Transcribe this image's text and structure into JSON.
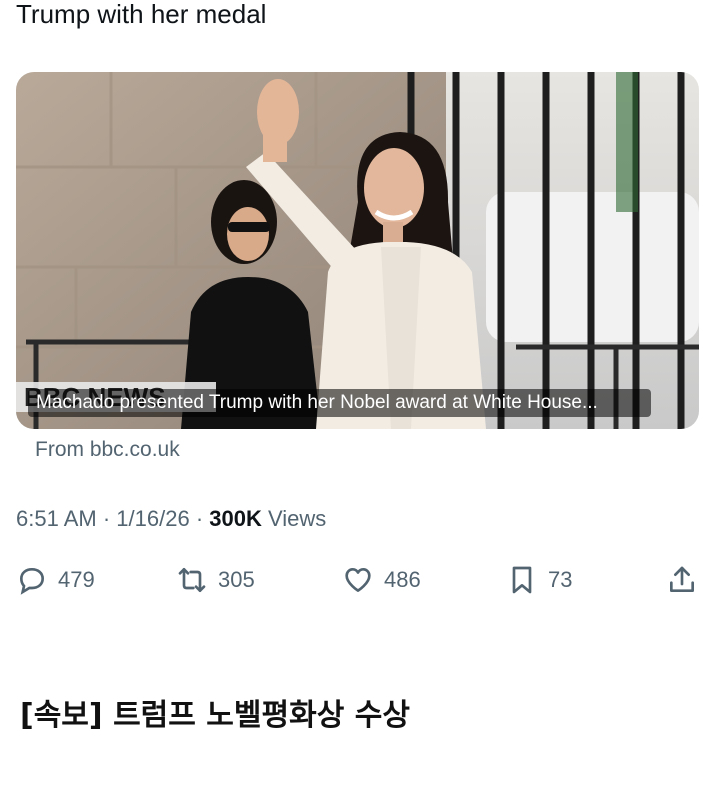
{
  "tweet": {
    "text": "Trump with her medal"
  },
  "link_card": {
    "caption": "Machado presented Trump with her Nobel award at White House...",
    "source": "From bbc.co.uk",
    "watermark": "BBC NEWS"
  },
  "meta": {
    "time": "6:51 AM",
    "separator": "·",
    "date": "1/16/26",
    "views_count": "300K",
    "views_label": "Views"
  },
  "actions": {
    "replies": "479",
    "reposts": "305",
    "likes": "486",
    "bookmarks": "73",
    "icons": [
      "reply-icon",
      "repost-icon",
      "like-icon",
      "bookmark-icon",
      "share-icon"
    ]
  },
  "headline": {
    "text": "[속보] 트럼프 노벨평화상 수상"
  },
  "colors": {
    "text_primary": "#0f1419",
    "text_secondary": "#536471",
    "background": "#ffffff"
  }
}
